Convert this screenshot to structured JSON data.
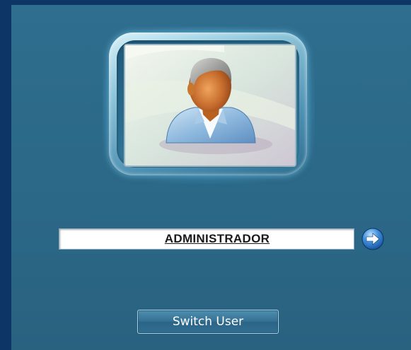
{
  "login": {
    "username": "ADMINISTRADOR",
    "submit_icon": "arrow-right-icon",
    "switch_user_label": "Switch User",
    "user_picture_icon": "user-avatar-icon"
  },
  "colors": {
    "background": "#2c6a8a",
    "frame": "#0d3565",
    "button_text": "#ffffff",
    "go_button": "#3a7fd0"
  }
}
